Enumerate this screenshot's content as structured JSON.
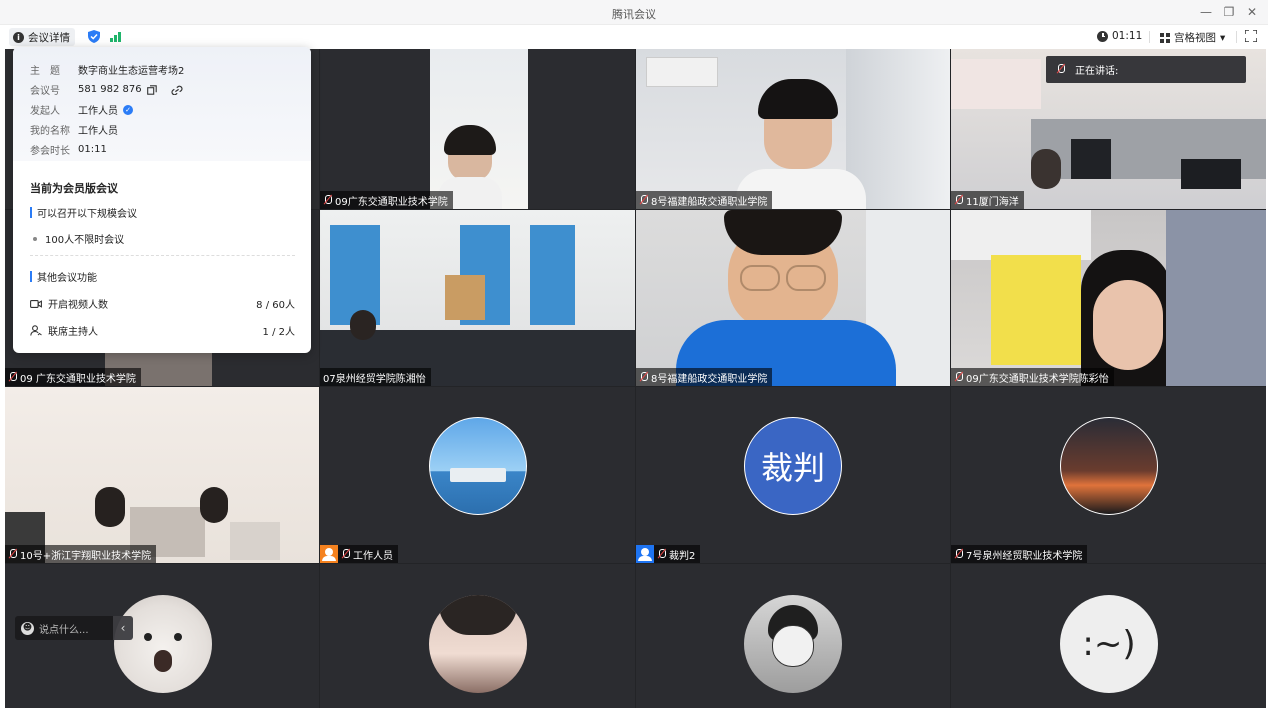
{
  "window": {
    "title": "腾讯会议",
    "minimize": "—",
    "restore": "❐",
    "close": "✕"
  },
  "toolbar": {
    "meeting_info_label": "会议详情",
    "elapsed": "01:11",
    "view_mode_label": "宫格视图",
    "view_mode_caret": "▾"
  },
  "meeting_info": {
    "rows": [
      {
        "label": "主　题",
        "value": "数字商业生态运营考场2"
      },
      {
        "label": "会议号",
        "value": "581 982 876"
      },
      {
        "label": "发起人",
        "value": "工作人员"
      },
      {
        "label": "我的名称",
        "value": "工作人员"
      },
      {
        "label": "参会时长",
        "value": "01:11"
      }
    ],
    "member_title": "当前为会员版会议",
    "section1_title": "可以召开以下规模会议",
    "section1_item": "100人不限时会议",
    "section2_title": "其他会议功能",
    "feature_video_label": "开启视频人数",
    "feature_video_value": "8 / 60人",
    "feature_cohost_label": "联席主持人",
    "feature_cohost_value": "1 / 2人"
  },
  "speaking": {
    "label": "正在讲话:"
  },
  "participants": [
    {
      "name": "09 广东交通职业技术学院"
    },
    {
      "name": "09广东交通职业技术学院"
    },
    {
      "name": "8号福建船政交通职业学院"
    },
    {
      "name": "11厦门海洋"
    },
    {
      "name": "07泉州经贸学院陈湘怡"
    },
    {
      "name": "8号福建船政交通职业学院"
    },
    {
      "name": "09广东交通职业技术学院陈彩怡"
    },
    {
      "name": "10号+浙江宇翔职业技术学院"
    },
    {
      "name": "工作人员"
    },
    {
      "name": "裁判2"
    },
    {
      "name": "7号泉州经贸职业技术学院"
    }
  ],
  "avatars": {
    "referee_text": "裁判",
    "smile_text": ":~)"
  },
  "chat": {
    "placeholder": "说点什么...",
    "collapse": "‹",
    "emoji": "☻"
  },
  "colors": {
    "accent": "#2b7cf6",
    "host_orange": "#f5821f",
    "host_blue": "#1e74f2",
    "signal": "#1fb56b"
  }
}
